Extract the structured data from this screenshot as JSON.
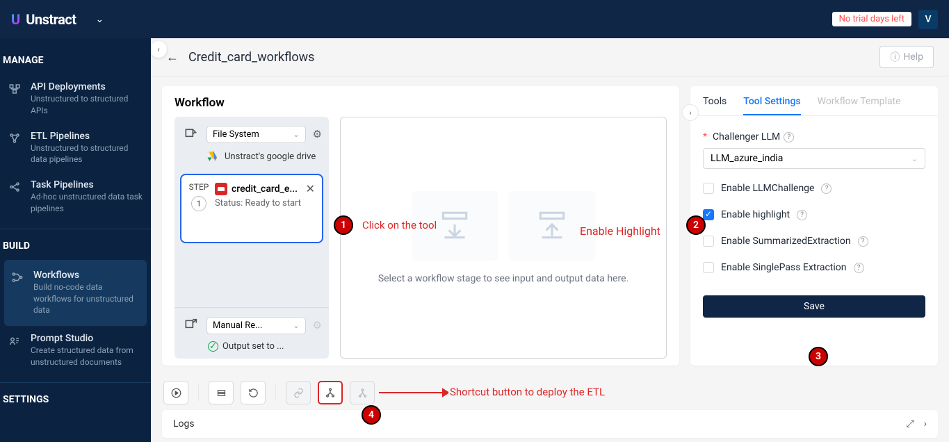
{
  "brand": {
    "name": "Unstract"
  },
  "topbar": {
    "trial": "No trial days left",
    "avatar_initial": "V"
  },
  "sidebar": {
    "manage_heading": "MANAGE",
    "build_heading": "BUILD",
    "settings_heading": "SETTINGS",
    "items": [
      {
        "title": "API Deployments",
        "sub": "Unstructured to structured APIs"
      },
      {
        "title": "ETL Pipelines",
        "sub": "Unstructured to structured data pipelines"
      },
      {
        "title": "Task Pipelines",
        "sub": "Ad-hoc unstructured data task pipelines"
      },
      {
        "title": "Workflows",
        "sub": "Build no-code data workflows for unstructured data"
      },
      {
        "title": "Prompt Studio",
        "sub": "Create structured data from unstructured documents"
      }
    ]
  },
  "page": {
    "title": "Credit_card_workflows",
    "help": "Help"
  },
  "workflow": {
    "heading": "Workflow",
    "input_select": "File System",
    "drive_label": "Unstract's google drive",
    "step_label": "STEP",
    "step_num": "1",
    "tool_name": "credit_card_e...",
    "tool_status": "Status: Ready to start",
    "output_select": "Manual Re...",
    "output_status": "Output set to ...",
    "empty_msg": "Select a workflow stage to see input and output data here."
  },
  "rightpanel": {
    "tabs": {
      "tools": "Tools",
      "settings": "Tool Settings",
      "template": "Workflow Template"
    },
    "challenger_label": "Challenger LLM",
    "challenger_value": "LLM_azure_india",
    "chk1": "Enable LLMChallenge",
    "chk2": "Enable highlight",
    "chk3": "Enable SummarizedExtraction",
    "chk4": "Enable SinglePass Extraction",
    "save": "Save"
  },
  "logs": {
    "title": "Logs"
  },
  "annotations": {
    "n1": "1",
    "t1": "Click on the tool",
    "n2": "2",
    "t2": "Enable Highlight",
    "n3": "3",
    "n4": "4",
    "t4": "Shortcut button to deploy the ETL"
  }
}
